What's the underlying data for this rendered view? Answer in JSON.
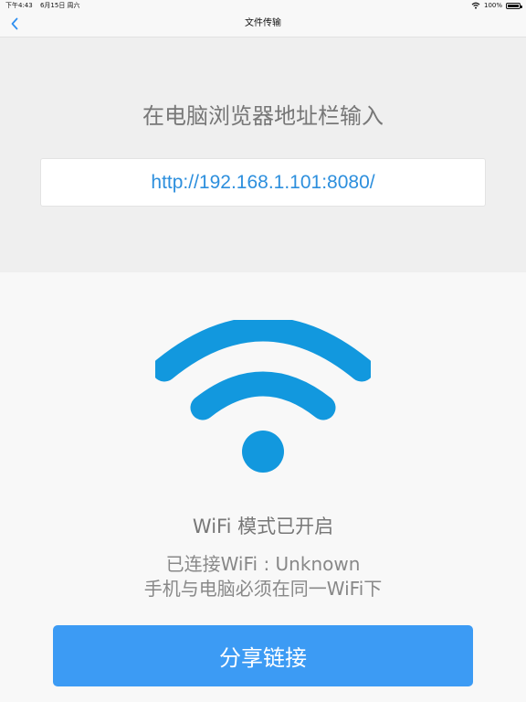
{
  "status_bar": {
    "time": "下午4:43",
    "date": "6月15日 周六",
    "battery": "100%",
    "wifi_icon": "wifi-icon",
    "battery_icon": "battery-icon"
  },
  "nav": {
    "title": "文件传输",
    "back_icon": "chevron-left-icon"
  },
  "transfer": {
    "instruction": "在电脑浏览器地址栏输入",
    "url": "http://192.168.1.101:8080/"
  },
  "wifi": {
    "icon": "wifi-icon",
    "icon_color": "#1298de",
    "mode_text": "WiFi 模式已开启",
    "connected_text": "已连接WiFi : Unknown",
    "requirement_text": "手机与电脑必须在同一WiFi下"
  },
  "share": {
    "label": "分享链接",
    "color": "#3c9bf4"
  }
}
